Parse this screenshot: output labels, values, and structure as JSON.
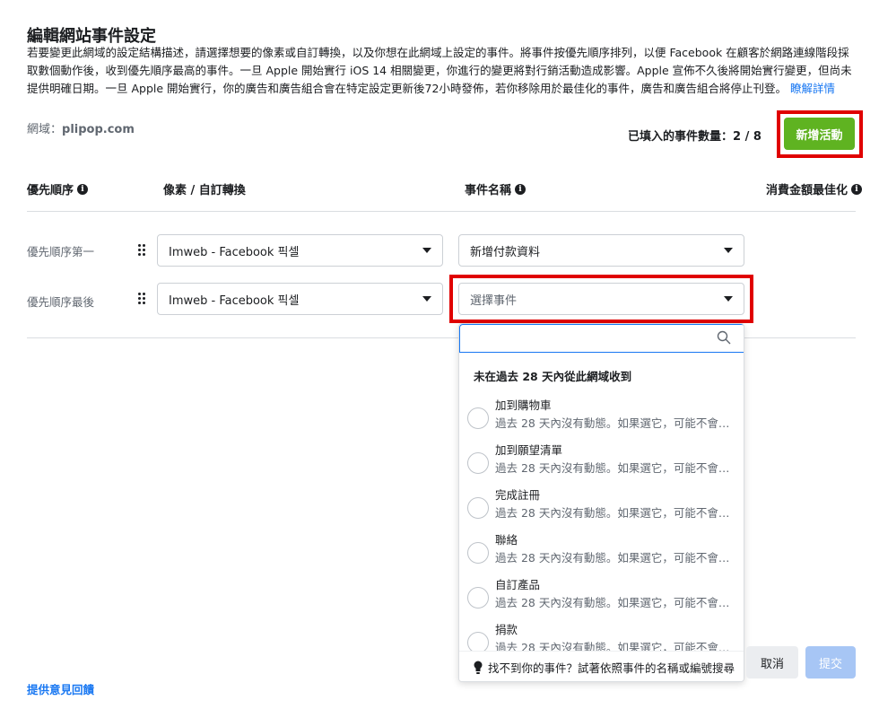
{
  "header": {
    "title": "編輯網站事件設定",
    "description": "若要變更此網域的設定結構描述，請選擇想要的像素或自訂轉換，以及你想在此網域上設定的事件。將事件按優先順序排列，以便 Facebook 在顧客於網路連線階段採取數個動作後，收到優先順序最高的事件。一旦 Apple 開始實行 iOS 14 相關變更，你進行的變更將對行銷活動造成影響。Apple 宣佈不久後將開始實行變更，但尚未提供明確日期。一旦 Apple 開始實行，你的廣告和廣告組合會在特定設定更新後72小時發佈，若你移除用於最佳化的事件，廣告和廣告組合將停止刊登。",
    "learn_more": "瞭解詳情"
  },
  "domain": {
    "label": "網域：",
    "value": "plipop.com"
  },
  "events_count": "已填入的事件數量：2 / 8",
  "add_button": "新增活動",
  "columns": {
    "priority": "優先順序",
    "pixel": "像素 / 自訂轉換",
    "event_name": "事件名稱",
    "value_opt": "消費金額最佳化"
  },
  "rows": [
    {
      "label": "優先順序第一",
      "pixel": "Imweb - Facebook 픽셀",
      "event": "新增付款資料"
    },
    {
      "label": "優先順序最後",
      "pixel": "Imweb - Facebook 픽셀",
      "event_placeholder": "選擇事件"
    }
  ],
  "dropdown": {
    "search_value": "",
    "section_title": "未在過去 28 天內從此網域收到",
    "items": [
      {
        "name": "加到購物車",
        "sub": "過去 28 天內沒有動態。如果選它，可能不會回報..."
      },
      {
        "name": "加到願望清單",
        "sub": "過去 28 天內沒有動態。如果選它，可能不會回報..."
      },
      {
        "name": "完成註冊",
        "sub": "過去 28 天內沒有動態。如果選它，可能不會回報..."
      },
      {
        "name": "聯絡",
        "sub": "過去 28 天內沒有動態。如果選它，可能不會回報..."
      },
      {
        "name": "自訂產品",
        "sub": "過去 28 天內沒有動態。如果選它，可能不會回報..."
      },
      {
        "name": "捐款",
        "sub": "過去 28 天內沒有動態。如果選它，可能不會回報..."
      }
    ],
    "footer": "找不到你的事件？試著依照事件的名稱或編號搜尋"
  },
  "footer": {
    "cancel": "取消",
    "submit": "提交",
    "feedback": "提供意見回饋"
  },
  "colors": {
    "accent": "#1877f2",
    "add_button": "#5fb321",
    "highlight": "#e00000",
    "submit_disabled": "#a7c6f5"
  }
}
